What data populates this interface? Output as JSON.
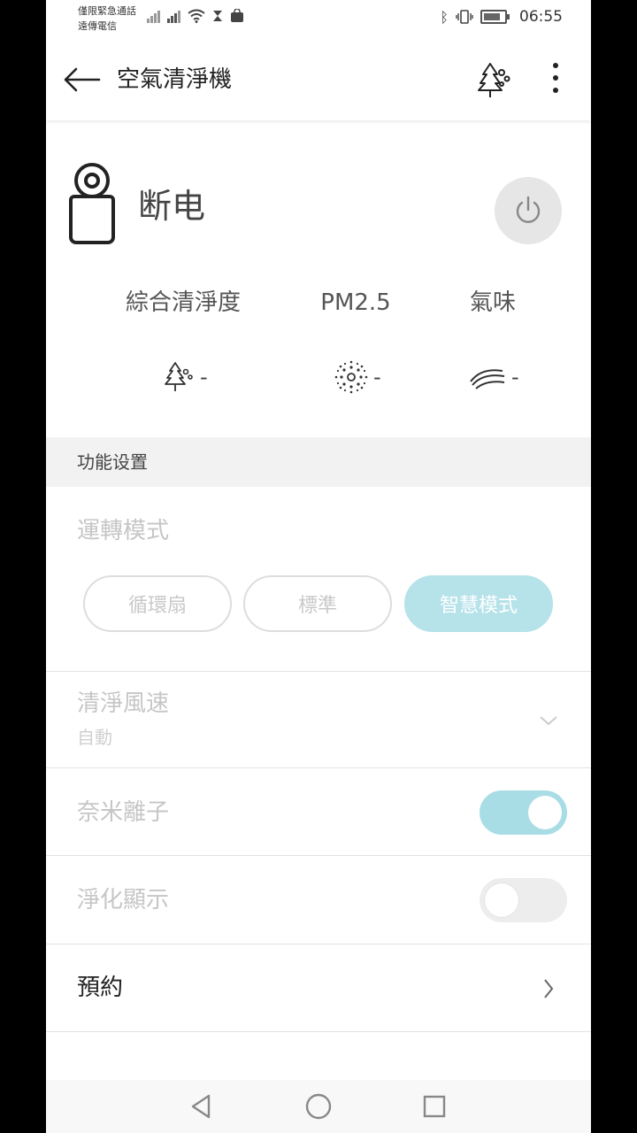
{
  "status_bar": {
    "carrier_line1": "僅限緊急通話",
    "carrier_line2": "遠傳電信",
    "time": "06:55"
  },
  "app_bar": {
    "title": "空氣清淨機",
    "icons": [
      "back-arrow-icon",
      "tree-icon",
      "more-vertical-icon"
    ]
  },
  "device": {
    "status": "断电",
    "icons": [
      "purifier-device-icon",
      "power-icon"
    ]
  },
  "metrics": [
    {
      "label": "綜合清淨度",
      "value": "-",
      "icon": "tree-icon"
    },
    {
      "label": "PM2.5",
      "value": "-",
      "icon": "particles-icon"
    },
    {
      "label": "氣味",
      "value": "-",
      "icon": "odor-waves-icon"
    }
  ],
  "settings": {
    "section_title": "功能设置",
    "mode": {
      "title": "運轉模式",
      "options": [
        "循環扇",
        "標準",
        "智慧模式"
      ],
      "selected": "智慧模式"
    },
    "fan_speed": {
      "title": "清淨風速",
      "value": "自動"
    },
    "ion": {
      "title": "奈米離子",
      "on": true
    },
    "display": {
      "title": "淨化顯示",
      "on": false
    },
    "reservation": {
      "title": "預約"
    }
  },
  "colors": {
    "accent": "#b6e2ea",
    "toggle_on": "#a9dde6",
    "section_bg": "#f2f2f2"
  }
}
